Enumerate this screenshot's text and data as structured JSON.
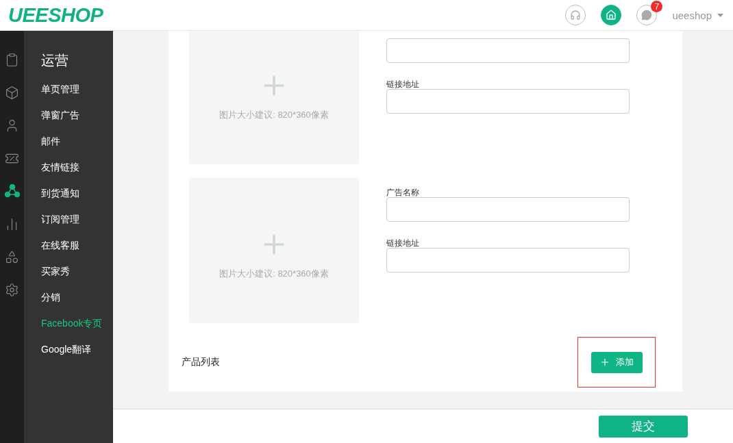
{
  "header": {
    "logo": "UEESHOP",
    "badge": "7",
    "user": "ueeshop"
  },
  "rail": [
    {
      "selected": false
    },
    {
      "selected": false
    },
    {
      "selected": false
    },
    {
      "selected": false
    },
    {
      "selected": true
    },
    {
      "selected": false
    },
    {
      "selected": false
    },
    {
      "selected": false
    }
  ],
  "menu": {
    "title": "运营",
    "items": [
      {
        "label": "单页管理",
        "selected": false
      },
      {
        "label": "弹窗广告",
        "selected": false
      },
      {
        "label": "邮件",
        "selected": false
      },
      {
        "label": "友情链接",
        "selected": false
      },
      {
        "label": "到货通知",
        "selected": false
      },
      {
        "label": "订阅管理",
        "selected": false
      },
      {
        "label": "在线客服",
        "selected": false
      },
      {
        "label": "买家秀",
        "selected": false
      },
      {
        "label": "分销",
        "selected": false
      },
      {
        "label": "Facebook专页",
        "selected": true
      },
      {
        "label": "Google翻译",
        "selected": false
      }
    ]
  },
  "ads": [
    {
      "hint": "图片大小建议: 820*360像素",
      "link_label": "链接地址"
    },
    {
      "hint": "图片大小建议: 820*360像素",
      "name_label": "广告名称",
      "link_label": "链接地址"
    }
  ],
  "products": {
    "label": "产品列表",
    "add_button": "添加",
    "highlighted": true
  },
  "submit": "提交"
}
